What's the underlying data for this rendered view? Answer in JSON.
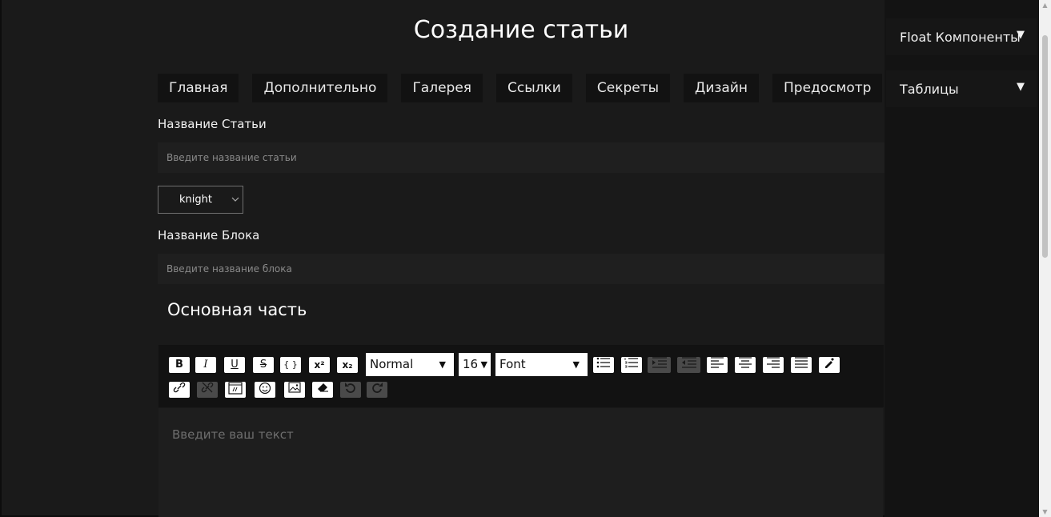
{
  "page": {
    "title": "Создание статьи"
  },
  "tabs": [
    "Главная",
    "Дополнительно",
    "Галерея",
    "Ссылки",
    "Секреты",
    "Дизайн",
    "Предосмотр"
  ],
  "form": {
    "article_name_label": "Название Статьи",
    "article_name_placeholder": "Введите название статьи",
    "template_select_value": "knight",
    "block_name_label": "Название Блока",
    "block_name_placeholder": "Введите название блока",
    "main_section_heading": "Основная часть"
  },
  "toolbar": {
    "row1_buttons": [
      "bold",
      "italic",
      "underline",
      "strikethrough",
      "code",
      "superscript",
      "subscript"
    ],
    "format_select": "Normal",
    "size_select": "16",
    "font_select": "Font",
    "row1_buttons_after": [
      "unordered-list",
      "ordered-list",
      "indent",
      "outdent",
      "align-left",
      "align-center",
      "align-right",
      "align-justify",
      "color-picker"
    ],
    "row2_buttons": [
      "link",
      "unlink",
      "embed",
      "emoji",
      "image",
      "eraser",
      "undo",
      "redo"
    ]
  },
  "editor": {
    "placeholder": "Введите ваш текст"
  },
  "sidebar": {
    "items": [
      {
        "label": "Float Компоненты",
        "arrow": "▼"
      },
      {
        "label": "Таблицы",
        "arrow": "▼"
      }
    ]
  },
  "colors": {
    "background": "#1a1a1a",
    "panel": "#121212",
    "input": "#1f1f1f",
    "text": "#f2f2f2"
  }
}
